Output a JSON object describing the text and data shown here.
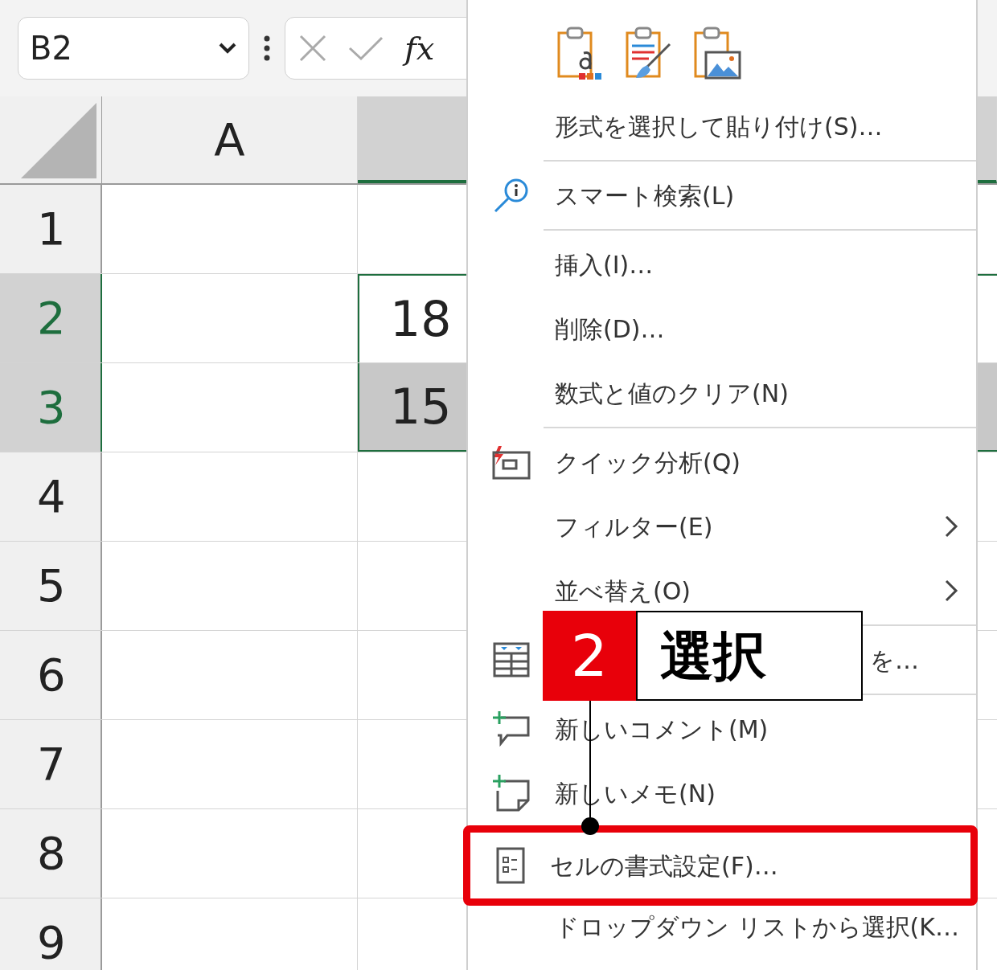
{
  "name_box": {
    "value": "B2"
  },
  "formula_bar": {
    "function_label": "fx"
  },
  "columns": [
    {
      "label": "A",
      "selected": false
    },
    {
      "selected": true
    }
  ],
  "rows": [
    {
      "number": "1",
      "selected": false
    },
    {
      "number": "2",
      "selected": true,
      "b": {
        "text": "18",
        "active": true
      }
    },
    {
      "number": "3",
      "selected": true,
      "b": {
        "text": "15",
        "active": false
      }
    },
    {
      "number": "4",
      "selected": false
    },
    {
      "number": "5",
      "selected": false
    },
    {
      "number": "6",
      "selected": false
    },
    {
      "number": "7",
      "selected": false
    },
    {
      "number": "8",
      "selected": false
    },
    {
      "number": "9",
      "selected": false
    }
  ],
  "context_menu": {
    "sections": [
      [
        {
          "label": "形式を選択して貼り付け(S)…",
          "submenu": false,
          "highlighted": false
        }
      ],
      [
        {
          "label": "スマート検索(L)",
          "submenu": false,
          "highlighted": false
        }
      ],
      [
        {
          "label": "挿入(I)…",
          "submenu": false,
          "highlighted": false
        },
        {
          "label": "削除(D)…",
          "submenu": false,
          "highlighted": false
        },
        {
          "label": "数式と値のクリア(N)",
          "submenu": false,
          "highlighted": false
        }
      ],
      [
        {
          "label": "クイック分析(Q)",
          "submenu": false,
          "highlighted": false
        },
        {
          "label": "フィルター(E)",
          "submenu": true,
          "highlighted": false
        },
        {
          "label": "並べ替え(O)",
          "submenu": true,
          "highlighted": false
        }
      ],
      [
        {
          "label": "を…",
          "submenu": false,
          "highlighted": false
        }
      ],
      [
        {
          "label": "新しいコメント(M)",
          "submenu": false,
          "highlighted": false
        },
        {
          "label": "新しいメモ(N)",
          "submenu": false,
          "highlighted": false
        },
        {
          "label": "セルの書式設定(F)…",
          "submenu": false,
          "highlighted": true
        },
        {
          "label": "ドロップダウン リストから選択(K…",
          "submenu": false,
          "highlighted": false
        }
      ]
    ]
  },
  "callout": {
    "step": "2",
    "text": "選択"
  }
}
